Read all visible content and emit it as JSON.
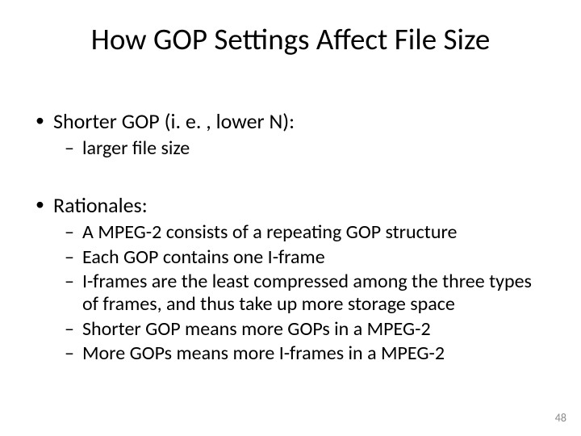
{
  "title": "How GOP Settings Affect File Size",
  "bullets": {
    "b1": "Shorter GOP (i. e. , lower N):",
    "b1_1": "larger file size",
    "b2": "Rationales:",
    "b2_1": "A MPEG-2 consists of a repeating GOP structure",
    "b2_2": "Each GOP contains one I-frame",
    "b2_3": "I-frames are the least compressed among the three types of frames, and thus take up more storage space",
    "b2_4": "Shorter GOP means more GOPs in a MPEG-2",
    "b2_5": "More GOPs means more I-frames in a MPEG-2"
  },
  "page_number": "48"
}
